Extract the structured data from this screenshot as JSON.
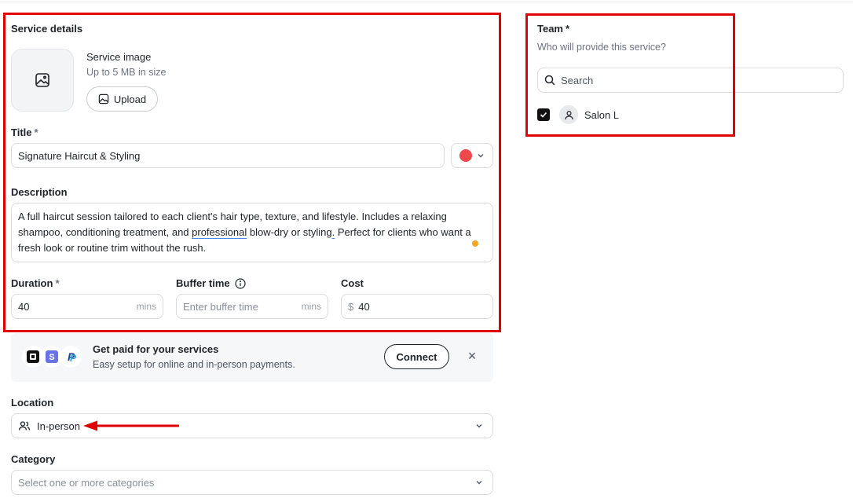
{
  "service_details": {
    "heading": "Service details",
    "image": {
      "title": "Service image",
      "hint": "Up to 5 MB in size",
      "upload_label": "Upload"
    },
    "title_field": {
      "label": "Title",
      "required_mark": "*",
      "value": "Signature Haircut & Styling",
      "color_swatch": "#f0474c"
    },
    "description": {
      "label": "Description",
      "line1": "A full haircut session tailored to each client's hair type, texture, and lifestyle. Includes a relaxing",
      "line2_a": "shampoo, conditioning treatment, and ",
      "line2_b": "professional",
      "line2_c": " blow-dry or styling",
      "line2_d": ".",
      "line2_e": " Perfect for clients who want a",
      "line3": "fresh look or routine trim without the rush."
    },
    "duration": {
      "label": "Duration",
      "required_mark": "*",
      "value": "40",
      "suffix": "mins"
    },
    "buffer": {
      "label": "Buffer time",
      "placeholder": "Enter buffer time",
      "suffix": "mins"
    },
    "cost": {
      "label": "Cost",
      "currency": "$",
      "value": "40"
    }
  },
  "payments_banner": {
    "title": "Get paid for your services",
    "subtitle": "Easy setup for online and in-person payments.",
    "connect_label": "Connect",
    "close_glyph": "×"
  },
  "location": {
    "label": "Location",
    "value": "In-person"
  },
  "category": {
    "label": "Category",
    "placeholder": "Select one or more categories"
  },
  "team": {
    "label": "Team",
    "required_mark": "*",
    "subtitle": "Who will provide this service?",
    "search_placeholder": "Search",
    "members": [
      {
        "name": "Salon L",
        "checked": true
      }
    ]
  },
  "colors": {
    "annotation_red": "#e00000",
    "dot_orange": "#f5a623"
  }
}
